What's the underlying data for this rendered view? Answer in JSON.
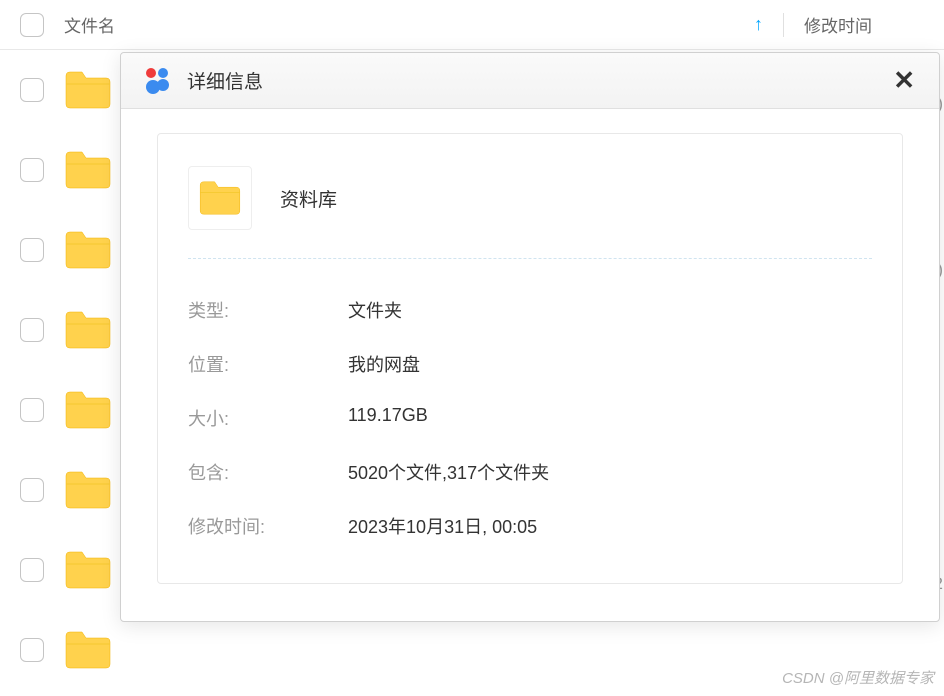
{
  "header": {
    "filename_label": "文件名",
    "modtime_label": "修改时间"
  },
  "dialog": {
    "title": "详细信息",
    "folder_name": "资料库",
    "props": {
      "type_label": "类型:",
      "type_value": "文件夹",
      "location_label": "位置:",
      "location_value": "我的网盘",
      "size_label": "大小:",
      "size_value": "119.17GB",
      "contains_label": "包含:",
      "contains_value": "5020个文件,317个文件夹",
      "modtime_label": "修改时间:",
      "modtime_value": "2023年10月31日, 00:05"
    }
  },
  "watermark": "CSDN @阿里数据专家"
}
